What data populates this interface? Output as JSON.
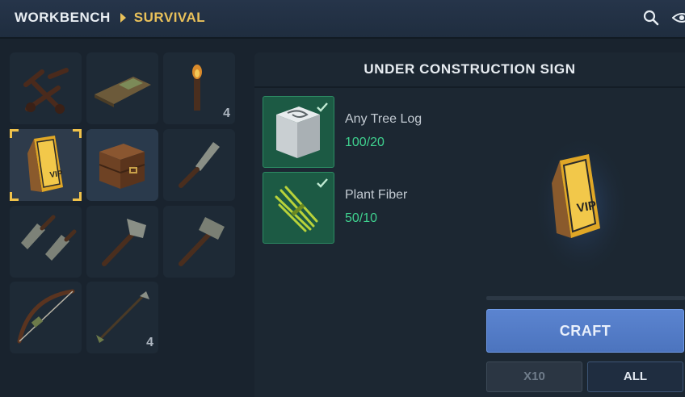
{
  "breadcrumb": {
    "root": "WORKBENCH",
    "current": "SURVIVAL"
  },
  "header_icons": [
    "search-icon",
    "eye-icon"
  ],
  "items": [
    {
      "name": "catapult",
      "count": ""
    },
    {
      "name": "bedroll",
      "count": ""
    },
    {
      "name": "torch",
      "count": "4"
    },
    {
      "name": "vip-sign",
      "count": "",
      "selected": true
    },
    {
      "name": "wooden-chest",
      "count": ""
    },
    {
      "name": "stone-knife",
      "count": ""
    },
    {
      "name": "stone-daggers",
      "count": ""
    },
    {
      "name": "stone-axe",
      "count": ""
    },
    {
      "name": "stone-hammer",
      "count": ""
    },
    {
      "name": "bow",
      "count": ""
    },
    {
      "name": "arrow",
      "count": "4"
    }
  ],
  "recipe": {
    "title": "UNDER CONSTRUCTION SIGN",
    "ingredients": [
      {
        "name": "Any Tree Log",
        "qty": "100/20",
        "icon": "tree-log-icon"
      },
      {
        "name": "Plant Fiber",
        "qty": "50/10",
        "icon": "plant-fiber-icon"
      }
    ]
  },
  "actions": {
    "craft": "CRAFT",
    "x10": "X10",
    "all": "ALL"
  },
  "colors": {
    "accent": "#e9c15a",
    "craft": "#5b84d0",
    "ok": "#3fd18f",
    "ingredient_bg": "#1c5a44"
  }
}
